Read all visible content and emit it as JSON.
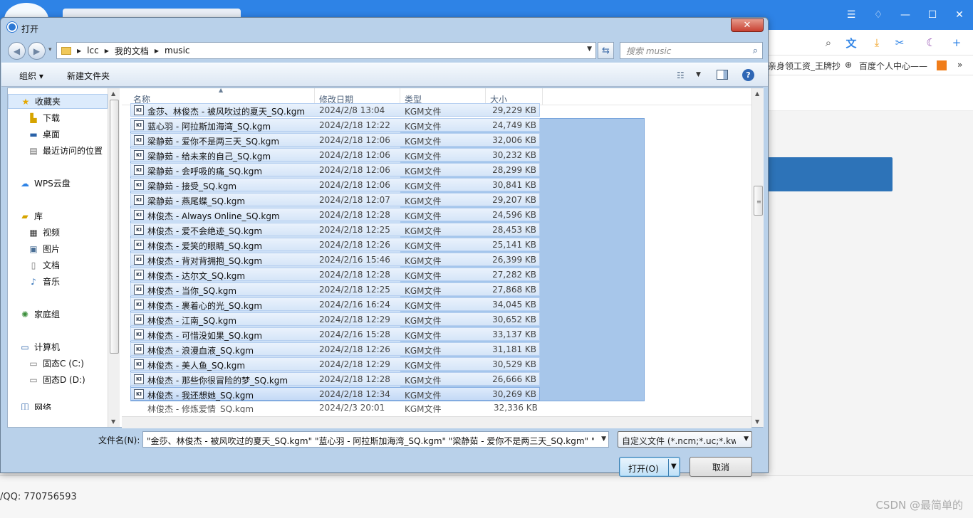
{
  "browser": {
    "bookmarks": [
      "亲身领工资_王牌抄",
      "百度个人中心——"
    ],
    "footer_qq": "/QQ: 770756593",
    "watermark": "CSDN @最简单的"
  },
  "dialog": {
    "title": "打开",
    "close_label": "✕",
    "breadcrumb": [
      "lcc",
      "我的文档",
      "music"
    ],
    "search_placeholder": "搜索 music",
    "organize_label": "组织 ▾",
    "new_folder_label": "新建文件夹",
    "sidebar": {
      "favorites": "收藏夹",
      "downloads": "下载",
      "desktop": "桌面",
      "recent": "最近访问的位置",
      "wps_cloud": "WPS云盘",
      "libraries": "库",
      "videos": "视频",
      "pictures": "图片",
      "documents": "文档",
      "music": "音乐",
      "homegroup": "家庭组",
      "computer": "计算机",
      "drive_c": "固态C (C:)",
      "drive_d": "固态D (D:)",
      "network": "网络"
    },
    "columns": {
      "name": "名称",
      "date": "修改日期",
      "type": "类型",
      "size": "大小"
    },
    "files": [
      {
        "name": "金莎、林俊杰 - 被风吹过的夏天_SQ.kgm",
        "date": "2024/2/8 13:04",
        "type": "KGM文件",
        "size": "29,229 KB"
      },
      {
        "name": "蓝心羽 - 阿拉斯加海湾_SQ.kgm",
        "date": "2024/2/18 12:22",
        "type": "KGM文件",
        "size": "24,749 KB"
      },
      {
        "name": "梁静茹 - 爱你不是两三天_SQ.kgm",
        "date": "2024/2/18 12:06",
        "type": "KGM文件",
        "size": "32,006 KB"
      },
      {
        "name": "梁静茹 - 给未来的自己_SQ.kgm",
        "date": "2024/2/18 12:06",
        "type": "KGM文件",
        "size": "30,232 KB"
      },
      {
        "name": "梁静茹 - 会呼吸的痛_SQ.kgm",
        "date": "2024/2/18 12:06",
        "type": "KGM文件",
        "size": "28,299 KB"
      },
      {
        "name": "梁静茹 - 接受_SQ.kgm",
        "date": "2024/2/18 12:06",
        "type": "KGM文件",
        "size": "30,841 KB"
      },
      {
        "name": "梁静茹 - 燕尾蝶_SQ.kgm",
        "date": "2024/2/18 12:07",
        "type": "KGM文件",
        "size": "29,207 KB"
      },
      {
        "name": "林俊杰 - Always Online_SQ.kgm",
        "date": "2024/2/18 12:28",
        "type": "KGM文件",
        "size": "24,596 KB"
      },
      {
        "name": "林俊杰 - 爱不会绝迹_SQ.kgm",
        "date": "2024/2/18 12:25",
        "type": "KGM文件",
        "size": "28,453 KB"
      },
      {
        "name": "林俊杰 - 爱笑的眼睛_SQ.kgm",
        "date": "2024/2/18 12:26",
        "type": "KGM文件",
        "size": "25,141 KB"
      },
      {
        "name": "林俊杰 - 背对背拥抱_SQ.kgm",
        "date": "2024/2/16 15:46",
        "type": "KGM文件",
        "size": "26,399 KB"
      },
      {
        "name": "林俊杰 - 达尔文_SQ.kgm",
        "date": "2024/2/18 12:28",
        "type": "KGM文件",
        "size": "27,282 KB"
      },
      {
        "name": "林俊杰 - 当你_SQ.kgm",
        "date": "2024/2/18 12:25",
        "type": "KGM文件",
        "size": "27,868 KB"
      },
      {
        "name": "林俊杰 - 裹着心的光_SQ.kgm",
        "date": "2024/2/16 16:24",
        "type": "KGM文件",
        "size": "34,045 KB"
      },
      {
        "name": "林俊杰 - 江南_SQ.kgm",
        "date": "2024/2/18 12:29",
        "type": "KGM文件",
        "size": "30,652 KB"
      },
      {
        "name": "林俊杰 - 可惜没如果_SQ.kgm",
        "date": "2024/2/16 15:28",
        "type": "KGM文件",
        "size": "33,137 KB"
      },
      {
        "name": "林俊杰 - 浪漫血液_SQ.kgm",
        "date": "2024/2/18 12:26",
        "type": "KGM文件",
        "size": "31,181 KB"
      },
      {
        "name": "林俊杰 - 美人鱼_SQ.kgm",
        "date": "2024/2/18 12:29",
        "type": "KGM文件",
        "size": "30,529 KB"
      },
      {
        "name": "林俊杰 - 那些你很冒险的梦_SQ.kgm",
        "date": "2024/2/18 12:28",
        "type": "KGM文件",
        "size": "26,666 KB"
      },
      {
        "name": "林俊杰 - 我还想她_SQ.kgm",
        "date": "2024/2/18 12:34",
        "type": "KGM文件",
        "size": "30,269 KB"
      }
    ],
    "partial_file": {
      "name": "林俊杰 - 修炼爱情_SQ.kgm",
      "date": "2024/2/3 20:01",
      "type": "KGM文件",
      "size": "32,336 KB"
    },
    "filename_label": "文件名(N):",
    "filename_value": "\"金莎、林俊杰 - 被风吹过的夏天_SQ.kgm\" \"蓝心羽 - 阿拉斯加海湾_SQ.kgm\" \"梁静茹 - 爱你不是两三天_SQ.kgm\" \"梁",
    "filter_value": "自定义文件 (*.ncm;*.uc;*.kwm;",
    "open_label": "打开(O)",
    "cancel_label": "取消"
  }
}
